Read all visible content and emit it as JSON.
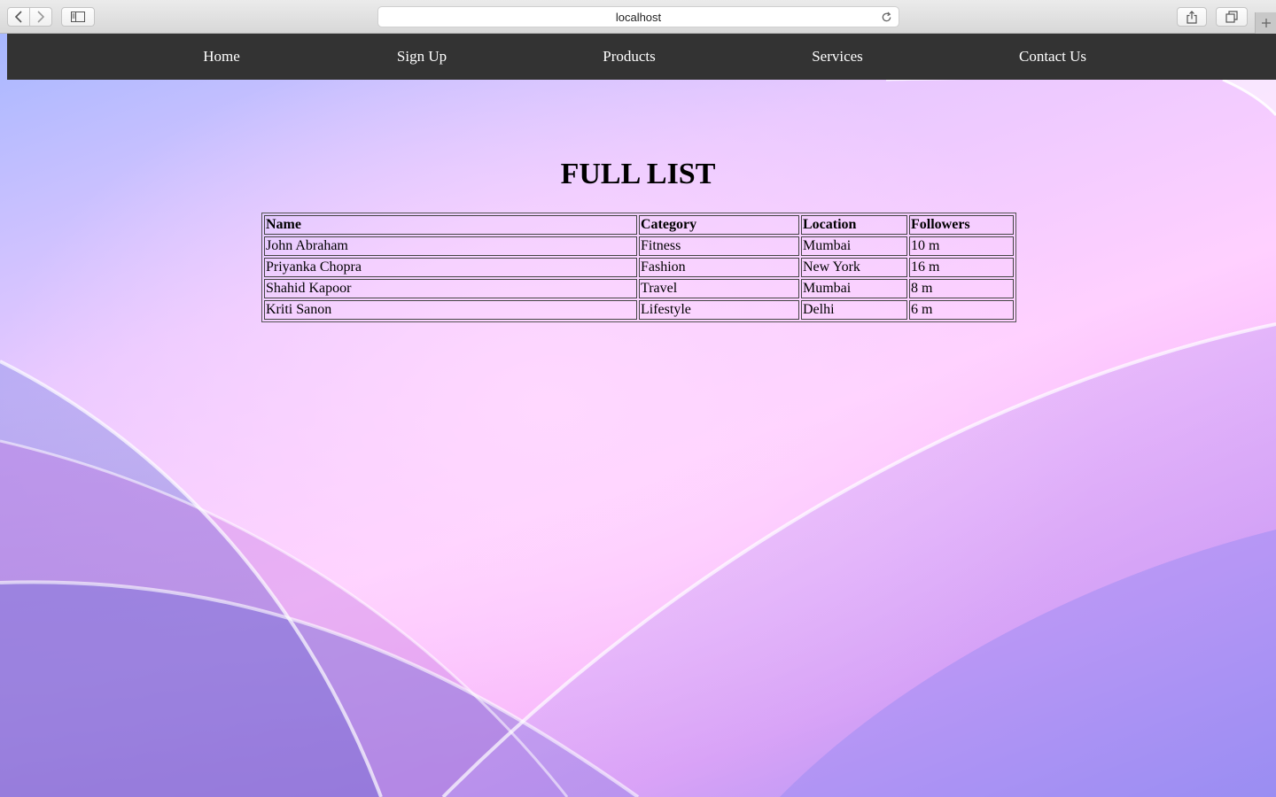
{
  "browser": {
    "url": "localhost",
    "icons": [
      "chevron-left-icon",
      "chevron-right-icon",
      "sidebar-icon",
      "reload-icon",
      "share-icon",
      "tabs-icon",
      "plus-icon"
    ]
  },
  "nav": {
    "items": [
      {
        "label": "Home"
      },
      {
        "label": "Sign Up"
      },
      {
        "label": "Products"
      },
      {
        "label": "Services"
      },
      {
        "label": "Contact Us"
      }
    ],
    "background": "#333333"
  },
  "main": {
    "title": "FULL LIST",
    "table": {
      "headers": [
        "Name",
        "Category",
        "Location",
        "Followers"
      ],
      "rows": [
        [
          "John Abraham",
          "Fitness",
          "Mumbai",
          "10 m"
        ],
        [
          "Priyanka Chopra",
          "Fashion",
          "New York",
          "16 m"
        ],
        [
          "Shahid Kapoor",
          "Travel",
          "Mumbai",
          "8 m"
        ],
        [
          "Kriti Sanon",
          "Lifestyle",
          "Delhi",
          "6 m"
        ]
      ]
    }
  }
}
